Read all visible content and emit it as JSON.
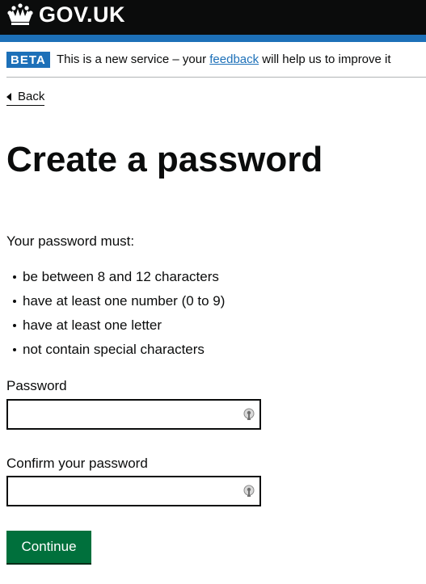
{
  "header": {
    "logo_text": "GOV.UK",
    "logo_icon": "crown-icon"
  },
  "phase_banner": {
    "tag": "BETA",
    "text_before": "This is a new service – your ",
    "link_text": "feedback",
    "text_after": " will help us to improve it"
  },
  "back_link": {
    "label": "Back"
  },
  "page": {
    "title": "Create a password",
    "intro": "Your password must:",
    "rules": [
      "be between 8 and 12 characters",
      "have at least one number (0 to 9)",
      "have at least one letter",
      "not contain special characters"
    ]
  },
  "form": {
    "password_label": "Password",
    "password_value": "",
    "confirm_label": "Confirm your password",
    "confirm_value": "",
    "field_icon": "password-manager-icon",
    "continue_label": "Continue"
  },
  "colors": {
    "header_bg": "#0b0c0c",
    "brand_blue": "#1d70b8",
    "button_green": "#00703c",
    "text": "#0b0c0c"
  }
}
